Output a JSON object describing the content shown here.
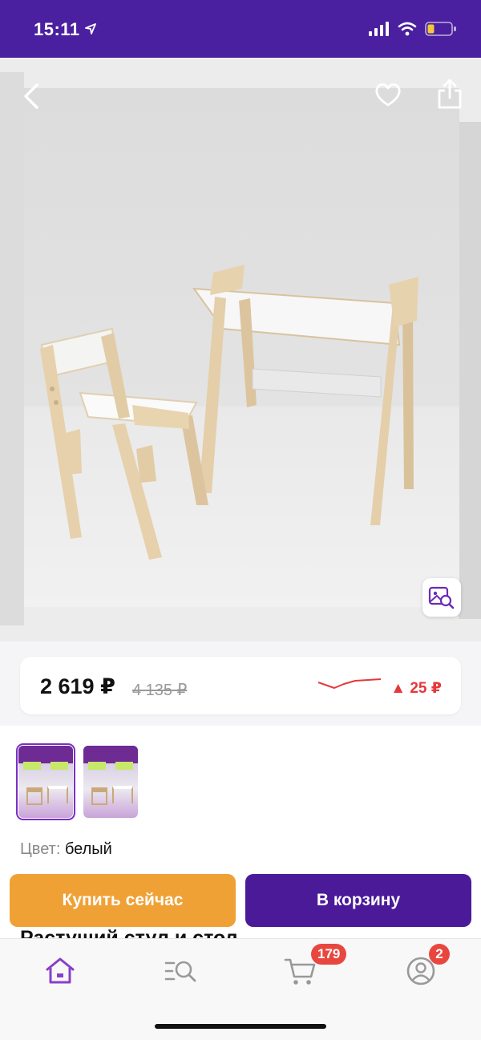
{
  "status_bar": {
    "time": "15:11"
  },
  "product": {
    "price": "2 619 ₽",
    "old_price": "4 135 ₽",
    "price_change": "▲ 25 ₽",
    "color_label": "Цвет:",
    "color_value": "белый",
    "title_partial": "Растущий стул и стол"
  },
  "actions": {
    "buy_now": "Купить сейчас",
    "add_to_cart": "В корзину"
  },
  "tabbar": {
    "cart_badge": "179",
    "profile_badge": "2"
  },
  "colors": {
    "brand": "#4a1fa0",
    "buy_now": "#f0a135",
    "add_to_cart": "#4a1a99",
    "price_up": "#e5383b",
    "badge": "#e8473f"
  }
}
